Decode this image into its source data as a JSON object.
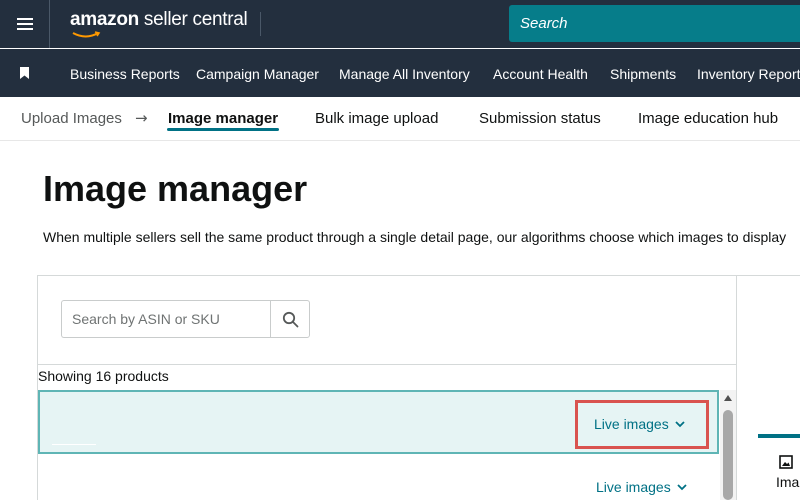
{
  "header": {
    "logo_brand": "amazon",
    "logo_sub": " seller central",
    "search_placeholder": "Search"
  },
  "nav": {
    "items": [
      {
        "label": "Business Reports"
      },
      {
        "label": "Campaign Manager"
      },
      {
        "label": "Manage All Inventory"
      },
      {
        "label": "Account Health"
      },
      {
        "label": "Shipments"
      },
      {
        "label": "Inventory Reports"
      }
    ]
  },
  "subtabs": {
    "items": [
      {
        "label": "Upload Images"
      },
      {
        "label": "Image manager"
      },
      {
        "label": "Bulk image upload"
      },
      {
        "label": "Submission status"
      },
      {
        "label": "Image education hub"
      }
    ],
    "active": "Image manager"
  },
  "page": {
    "title": "Image manager",
    "description": "When multiple sellers sell the same product through a single detail page, our algorithms choose which images to display"
  },
  "search": {
    "placeholder": "Search by ASIN or SKU",
    "value": ""
  },
  "list": {
    "summary": "Showing 16 products",
    "rows": [
      {
        "action_label": "Live images"
      },
      {
        "action_label": "Live images"
      }
    ]
  },
  "side_panel": {
    "tab_label": "Ima"
  },
  "icons": {
    "menu": "hamburger-icon",
    "bookmark": "bookmark-icon",
    "arrow": "arrow-right-icon",
    "search": "magnifier-icon",
    "chevron": "chevron-down-icon",
    "image": "image-icon"
  },
  "colors": {
    "header_bg": "#232f3e",
    "search_bg": "#067d8a",
    "accent": "#007185",
    "selected_row_bg": "#e6f4f4",
    "selected_row_border": "#5fb5b5",
    "highlight": "#d9534f"
  }
}
